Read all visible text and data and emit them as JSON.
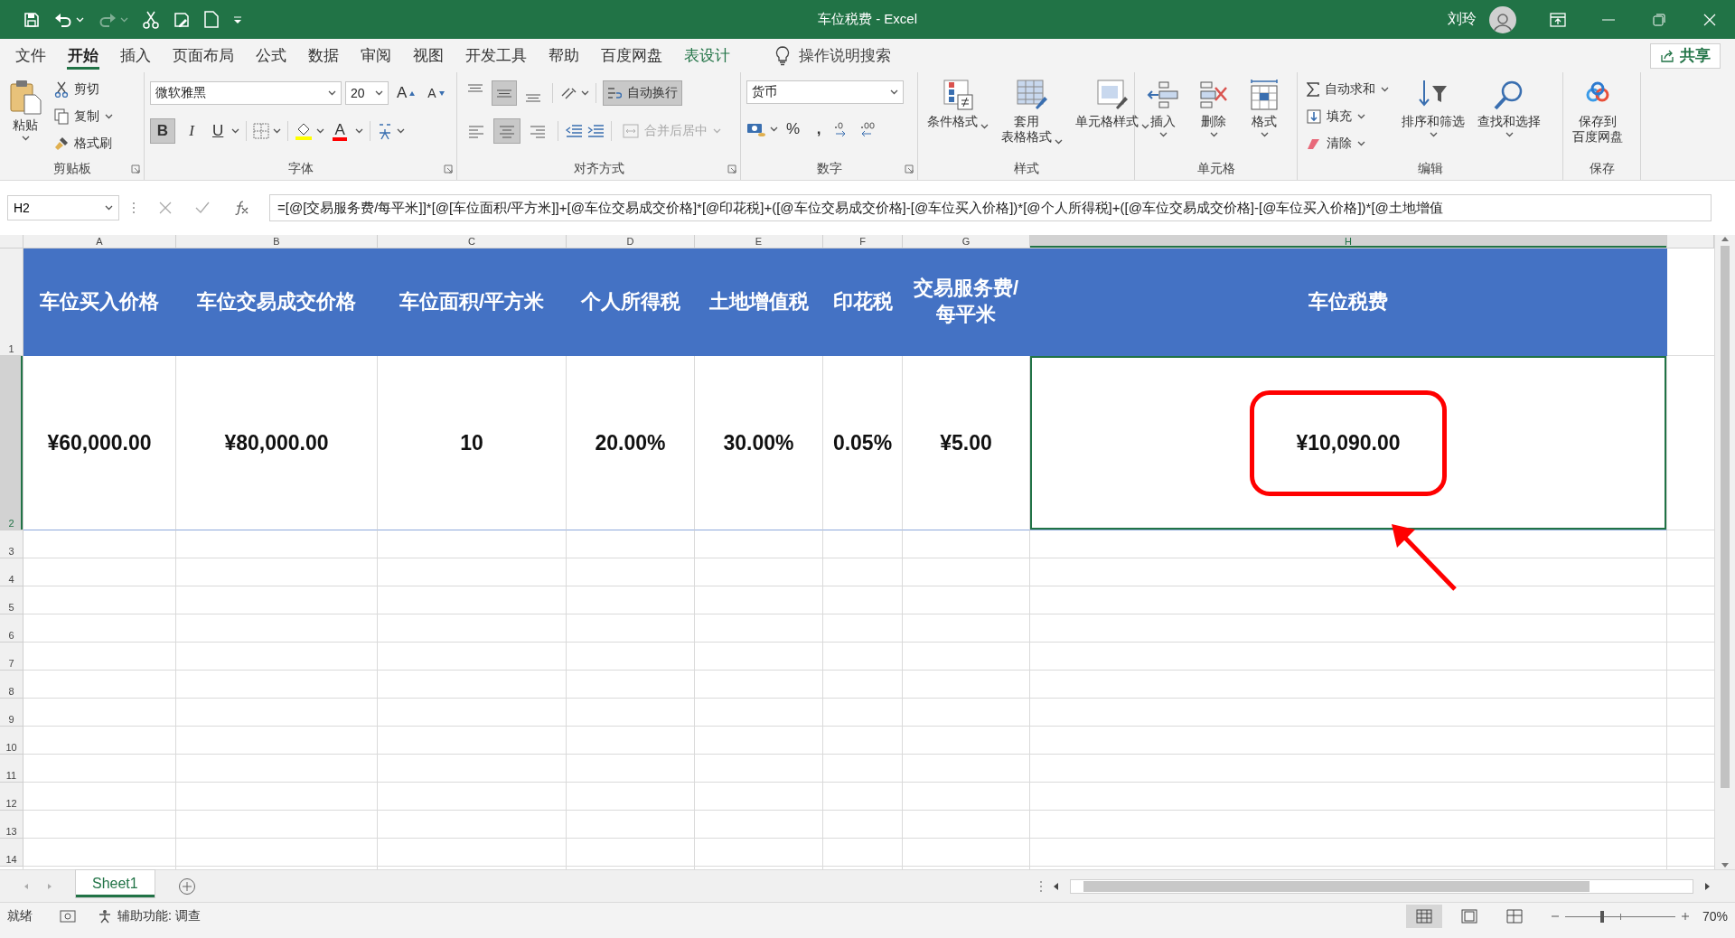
{
  "window": {
    "title": "车位税费 - Excel",
    "user": "刘玲"
  },
  "menu_tabs": [
    {
      "label": "文件",
      "selected": false,
      "kind": "normal"
    },
    {
      "label": "开始",
      "selected": true,
      "kind": "normal"
    },
    {
      "label": "插入",
      "selected": false,
      "kind": "normal"
    },
    {
      "label": "页面布局",
      "selected": false,
      "kind": "normal"
    },
    {
      "label": "公式",
      "selected": false,
      "kind": "normal"
    },
    {
      "label": "数据",
      "selected": false,
      "kind": "normal"
    },
    {
      "label": "审阅",
      "selected": false,
      "kind": "normal"
    },
    {
      "label": "视图",
      "selected": false,
      "kind": "normal"
    },
    {
      "label": "开发工具",
      "selected": false,
      "kind": "normal"
    },
    {
      "label": "帮助",
      "selected": false,
      "kind": "normal"
    },
    {
      "label": "百度网盘",
      "selected": false,
      "kind": "normal"
    },
    {
      "label": "表设计",
      "selected": false,
      "kind": "contextual"
    }
  ],
  "tell_me": {
    "placeholder": "操作说明搜索"
  },
  "share_button": "共享",
  "ribbon": {
    "clipboard": {
      "label": "剪贴板",
      "paste": "粘贴",
      "cut": "剪切",
      "copy": "复制",
      "format_painter": "格式刷"
    },
    "font": {
      "label": "字体",
      "font_name": "微软雅黑",
      "font_size": "20",
      "grow": "A",
      "shrink": "A",
      "bold": {
        "label": "B",
        "selected": true
      },
      "italic": {
        "label": "I",
        "selected": false
      },
      "underline": {
        "label": "U",
        "selected": false
      },
      "font_color": "A"
    },
    "alignment": {
      "label": "对齐方式",
      "vertical": [
        {
          "selected": false
        },
        {
          "selected": true
        },
        {
          "selected": false
        }
      ],
      "horizontal": [
        {
          "selected": false
        },
        {
          "selected": true
        },
        {
          "selected": false
        }
      ],
      "wrap_text": {
        "label": "自动换行",
        "selected": true
      },
      "merge_center": {
        "label": "合并后居中",
        "disabled": true
      }
    },
    "number": {
      "label": "数字",
      "format": "货币",
      "percent": "%",
      "comma": ","
    },
    "styles": {
      "label": "样式",
      "buttons": [
        [
          "条件格式"
        ],
        [
          "套用",
          "表格格式"
        ],
        [
          "单元格样式"
        ]
      ]
    },
    "cells": {
      "label": "单元格",
      "buttons": [
        "插入",
        "删除",
        "格式"
      ]
    },
    "editing": {
      "label": "编辑",
      "autosum": "自动求和",
      "fill": "填充",
      "clear": "清除",
      "sort_filter": "排序和筛选",
      "find_select": "查找和选择"
    },
    "save": {
      "label": "保存",
      "button": [
        "保存到",
        "百度网盘"
      ]
    }
  },
  "formula_bar": {
    "name_box": "H2",
    "formula": "=[@[交易服务费/每平米]]*[@[车位面积/平方米]]+[@车位交易成交价格]*[@印花税]+([@车位交易成交价格]-[@车位买入价格])*[@个人所得税]+([@车位交易成交价格]-[@车位买入价格])*[@土地增值"
  },
  "columns": [
    {
      "label": "A",
      "selected": false
    },
    {
      "label": "B",
      "selected": false
    },
    {
      "label": "C",
      "selected": false
    },
    {
      "label": "D",
      "selected": false
    },
    {
      "label": "E",
      "selected": false
    },
    {
      "label": "F",
      "selected": false
    },
    {
      "label": "G",
      "selected": false
    },
    {
      "label": "H",
      "selected": true
    }
  ],
  "rows": [
    {
      "label": "1",
      "selected": false
    },
    {
      "label": "2",
      "selected": true
    },
    {
      "label": "3",
      "selected": false
    },
    {
      "label": "4",
      "selected": false
    },
    {
      "label": "5",
      "selected": false
    },
    {
      "label": "6",
      "selected": false
    },
    {
      "label": "7",
      "selected": false
    },
    {
      "label": "8",
      "selected": false
    },
    {
      "label": "9",
      "selected": false
    },
    {
      "label": "10",
      "selected": false
    },
    {
      "label": "11",
      "selected": false
    },
    {
      "label": "12",
      "selected": false
    },
    {
      "label": "13",
      "selected": false
    },
    {
      "label": "14",
      "selected": false
    }
  ],
  "table": {
    "headers": [
      "车位买入价格",
      "车位交易成交价格",
      "车位面积/平方米",
      "个人所得税",
      "土地增值税",
      "印花税",
      "交易服务费/每平米",
      "车位税费"
    ],
    "values": [
      {
        "text": "¥60,000.00",
        "selected": false
      },
      {
        "text": "¥80,000.00",
        "selected": false
      },
      {
        "text": "10",
        "selected": false
      },
      {
        "text": "20.00%",
        "selected": false
      },
      {
        "text": "30.00%",
        "selected": false
      },
      {
        "text": "0.05%",
        "selected": false
      },
      {
        "text": "¥5.00",
        "selected": false
      },
      {
        "text": "¥10,090.00",
        "selected": true
      }
    ]
  },
  "sheets": [
    {
      "label": "Sheet1",
      "selected": true
    }
  ],
  "status_bar": {
    "ready": "就绪",
    "accessibility": "辅助功能: 调查",
    "views": [
      {
        "selected": true
      },
      {
        "selected": false
      },
      {
        "selected": false
      }
    ],
    "zoom": {
      "level": 0.34,
      "reading": "70%"
    }
  }
}
